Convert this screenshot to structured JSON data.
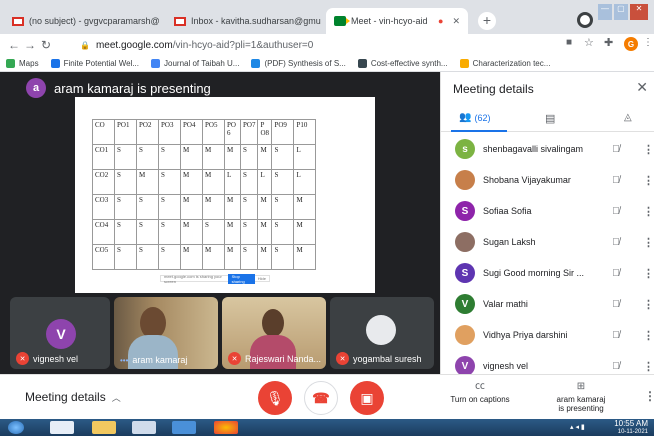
{
  "browser": {
    "tabs": [
      {
        "title": "(no subject) - gvgvcparamarsh@",
        "icon": "gmail-icon",
        "active": false
      },
      {
        "title": "Inbox - kavitha.sudharsan@gmu",
        "icon": "gmail-icon",
        "active": false
      },
      {
        "title": "Meet - vin-hcyo-aid",
        "icon": "meet-icon",
        "active": true
      }
    ],
    "new_tab": "+",
    "url_host": "meet.google.com",
    "url_path": "/vin-hcyo-aid?pli=1&authuser=0",
    "profile_initial": "G",
    "bookmarks": [
      {
        "label": "Maps",
        "color": "#34a853"
      },
      {
        "label": "Finite Potential Wel...",
        "color": "#1a73e8"
      },
      {
        "label": "Journal of Taibah U...",
        "color": "#4285f4"
      },
      {
        "label": "(PDF) Synthesis of S...",
        "color": "#1e88e5"
      },
      {
        "label": "Cost-effective synth...",
        "color": "#37474f"
      },
      {
        "label": "Characterization tec...",
        "color": "#f9ab00"
      }
    ]
  },
  "meet": {
    "presenter": {
      "initial": "a",
      "label": "aram kamaraj is presenting",
      "color": "#8e44ad"
    },
    "slide_table": {
      "headers": [
        "CO",
        "PO1",
        "PO2",
        "PO3",
        "PO4",
        "PO5",
        "PO 6",
        "PO7",
        "P O8",
        "PO9",
        "P10"
      ],
      "rows": [
        [
          "CO1",
          "S",
          "S",
          "S",
          "M",
          "M",
          "M",
          "S",
          "M",
          "S",
          "L"
        ],
        [
          "CO2",
          "S",
          "M",
          "S",
          "M",
          "M",
          "L",
          "S",
          "L",
          "S",
          "L"
        ],
        [
          "CO3",
          "S",
          "S",
          "S",
          "M",
          "M",
          "M",
          "S",
          "M",
          "S",
          "M"
        ],
        [
          "CO4",
          "S",
          "S",
          "S",
          "M",
          "S",
          "M",
          "S",
          "M",
          "S",
          "M"
        ],
        [
          "CO5",
          "S",
          "S",
          "S",
          "M",
          "M",
          "M",
          "S",
          "M",
          "S",
          "M"
        ]
      ]
    },
    "presenting_strip": {
      "text": "meet.google.com is sharing your screen",
      "stop": "Stop sharing",
      "hide": "Hide"
    },
    "tiles": [
      {
        "name": "vignesh vel",
        "initial": "V",
        "color": "#8e44ad",
        "muted": true
      },
      {
        "name": "aram kamaraj",
        "muted": false
      },
      {
        "name": "Rajeswari Nanda...",
        "muted": true
      },
      {
        "name": "yogambal suresh",
        "muted": true
      }
    ],
    "panel": {
      "title": "Meeting details",
      "people_count": "(62)",
      "participants": [
        {
          "name": "shenbagavalli sivalingam",
          "initial": "s",
          "color": "#7cb342"
        },
        {
          "name": "Shobana Vijayakumar",
          "initial": "",
          "color": "#c77f4a"
        },
        {
          "name": "Sofiaa Sofia",
          "initial": "S",
          "color": "#8e24aa"
        },
        {
          "name": "Sugan Laksh",
          "initial": "",
          "color": "#8d6e63"
        },
        {
          "name": "Sugi Good morning Sir ...",
          "initial": "S",
          "color": "#5e35b1"
        },
        {
          "name": "Valar mathi",
          "initial": "V",
          "color": "#2e7d32"
        },
        {
          "name": "Vidhya Priya darshini",
          "initial": "",
          "color": "#e0a060"
        },
        {
          "name": "vignesh vel",
          "initial": "V",
          "color": "#8e44ad"
        }
      ]
    },
    "bottom": {
      "meeting_details": "Meeting details",
      "captions": "Turn on captions",
      "presenting_line1": "aram kamaraj",
      "presenting_line2": "is presenting"
    }
  },
  "taskbar": {
    "time": "10:55 AM",
    "date": "10-11-2021"
  }
}
